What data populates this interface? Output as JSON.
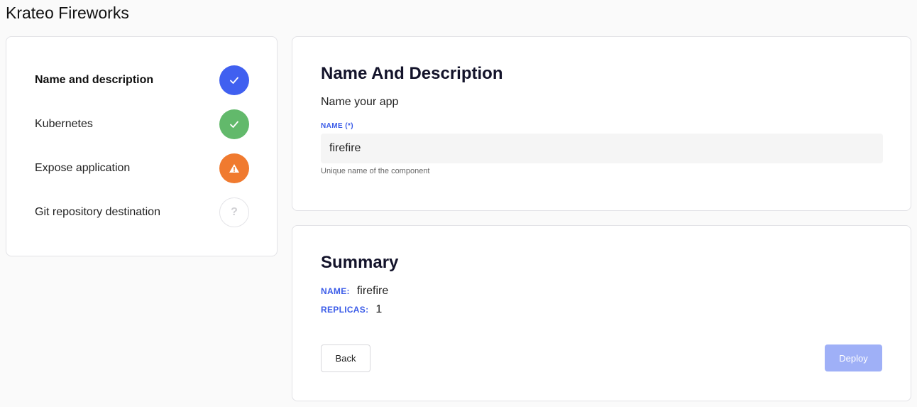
{
  "app": {
    "title": "Krateo Fireworks"
  },
  "steps": [
    {
      "label": "Name and description",
      "status": "done",
      "icon": "check-icon",
      "color": "#4060f0",
      "active": true
    },
    {
      "label": "Kubernetes",
      "status": "done",
      "icon": "check-icon",
      "color": "#62b96b"
    },
    {
      "label": "Expose application",
      "status": "warning",
      "icon": "warning-icon",
      "color": "#f07a2f"
    },
    {
      "label": "Git repository destination",
      "status": "pending",
      "icon": "question-icon",
      "glyph": "?"
    }
  ],
  "name_section": {
    "title": "Name And Description",
    "subtitle": "Name your app",
    "field_label": "NAME (*)",
    "field_value": "firefire",
    "helper": "Unique name of the component"
  },
  "summary": {
    "title": "Summary",
    "rows": [
      {
        "key": "NAME:",
        "value": "firefire"
      },
      {
        "key": "REPLICAS:",
        "value": "1"
      }
    ],
    "back_label": "Back",
    "deploy_label": "Deploy"
  },
  "colors": {
    "accent": "#3a5be8",
    "deploy_disabled": "#9fb0f7"
  }
}
